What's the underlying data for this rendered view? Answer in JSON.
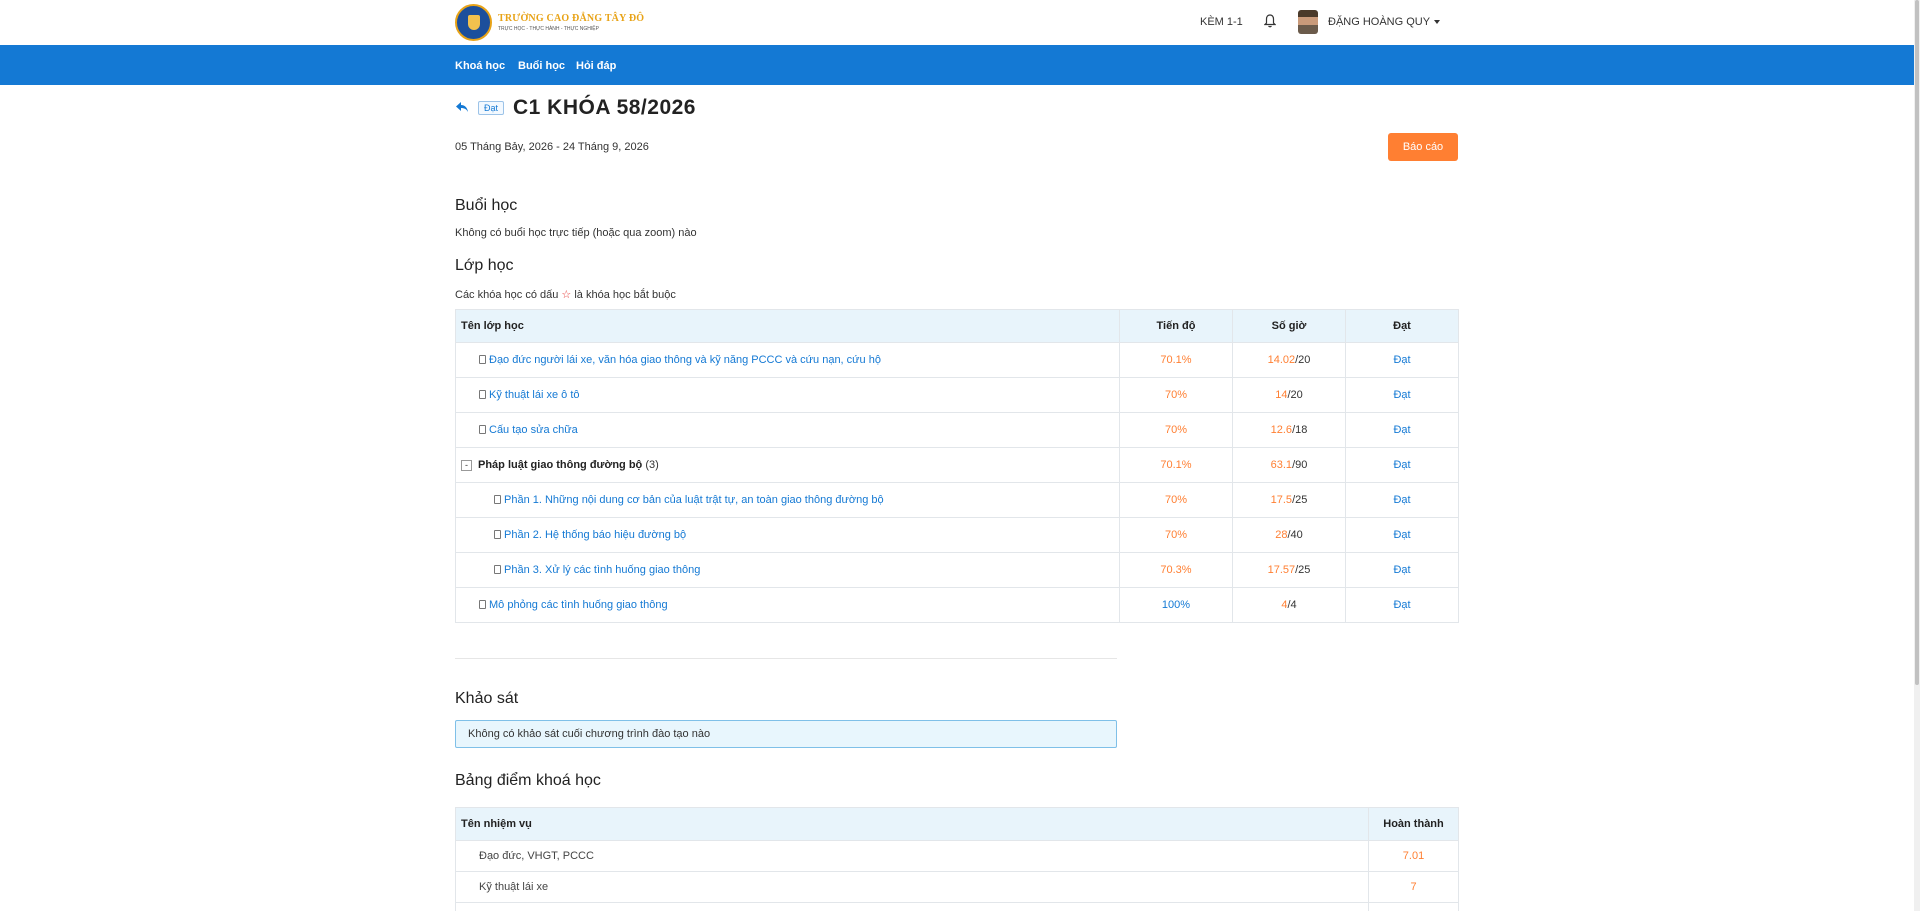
{
  "header": {
    "logo_title": "TRƯỜNG CAO ĐẲNG TÂY ĐÔ",
    "logo_subtitle": "TRỰC HỌC - THỰC HÀNH - THỰC NGHIỆP",
    "kem_label": "KÈM 1-1",
    "bell_icon": "bell-icon",
    "username": "ĐẶNG HOÀNG QUY"
  },
  "nav": {
    "items": [
      "Khoá học",
      "Buổi học",
      "Hỏi đáp"
    ]
  },
  "course": {
    "badge": "Đạt",
    "title": "C1 KHÓA 58/2026",
    "dates": "05 Tháng Bảy, 2026 - 24 Tháng 9, 2026",
    "report_button": "Báo cáo"
  },
  "sessions": {
    "heading": "Buổi học",
    "empty_text": "Không có buổi học trực tiếp (hoặc qua zoom) nào"
  },
  "classes": {
    "heading": "Lớp học",
    "note_before": "Các khóa học có dấu",
    "note_star": "☆",
    "note_after": "là khóa học bắt buộc",
    "columns": [
      "Tên lớp học",
      "Tiến độ",
      "Số giờ",
      "Đạt"
    ],
    "rows": [
      {
        "name": "Đạo đức người lái xe, văn hóa giao thông và kỹ năng PCCC và cứu nạn, cứu hộ",
        "progress": "70.1%",
        "hours_done": "14.02",
        "hours_total": "/20",
        "status": "Đạt"
      },
      {
        "name": "Kỹ thuật lái xe ô tô",
        "progress": "70%",
        "hours_done": "14",
        "hours_total": "/20",
        "status": "Đạt"
      },
      {
        "name": "Cấu tạo sửa chữa",
        "progress": "70%",
        "hours_done": "12.6",
        "hours_total": "/18",
        "status": "Đạt"
      },
      {
        "name": "Pháp luật giao thông đường bộ",
        "count": "(3)",
        "toggle": "-",
        "progress": "70.1%",
        "hours_done": "63.1",
        "hours_total": "/90",
        "status": "Đạt"
      },
      {
        "name": "Phần 1. Những nội dung cơ bản của luật trật tự, an toàn giao thông đường bộ",
        "progress": "70%",
        "hours_done": "17.5",
        "hours_total": "/25",
        "status": "Đạt"
      },
      {
        "name": "Phần 2. Hệ thống báo hiệu đường bộ",
        "progress": "70%",
        "hours_done": "28",
        "hours_total": "/40",
        "status": "Đạt"
      },
      {
        "name": "Phần 3. Xử lý các tình huống giao thông",
        "progress": "70.3%",
        "hours_done": "17.57",
        "hours_total": "/25",
        "status": "Đạt"
      },
      {
        "name": "Mô phỏng các tình huống giao thông",
        "progress": "100%",
        "hours_done": "4",
        "hours_total": "/4",
        "status": "Đạt"
      }
    ]
  },
  "survey": {
    "heading": "Khảo sát",
    "empty_text": "Không có khảo sát cuối chương trình đào tạo nào"
  },
  "grades": {
    "heading": "Bảng điểm khoá học",
    "columns": [
      "Tên nhiệm vụ",
      "Hoàn thành"
    ],
    "rows": [
      {
        "name": "Đạo đức, VHGT, PCCC",
        "score": "7.01"
      },
      {
        "name": "Kỹ thuật lái xe",
        "score": "7"
      }
    ]
  },
  "colors": {
    "primary": "#1479d4",
    "accent": "#ff7f32",
    "header_bg": "#e8f4fb"
  }
}
